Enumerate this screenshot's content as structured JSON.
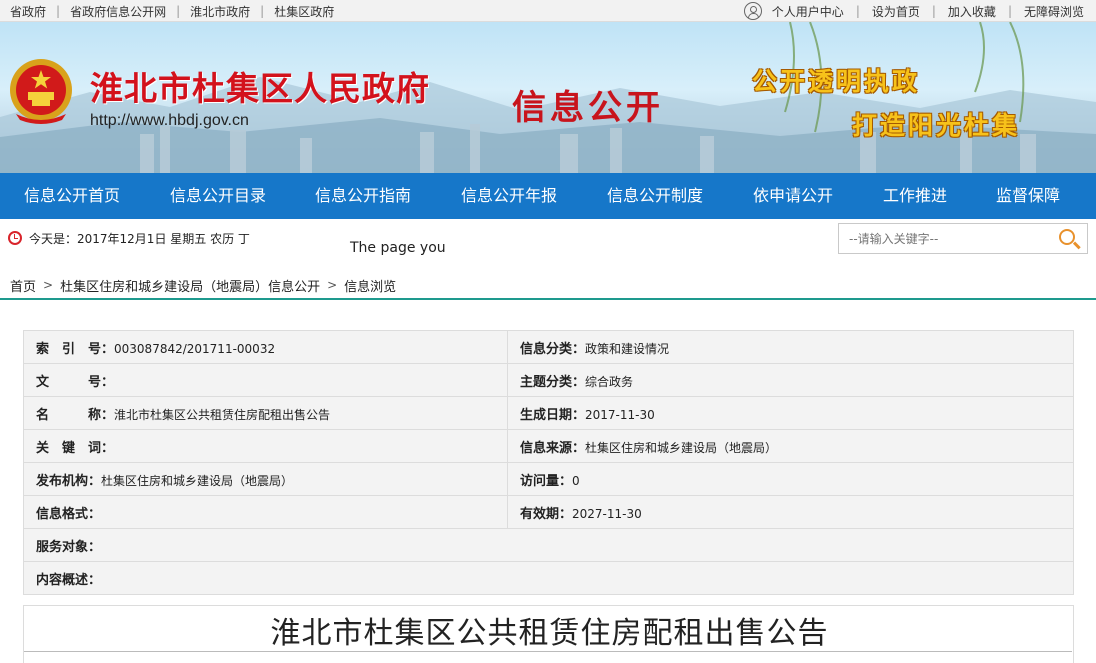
{
  "toplinks": [
    "省政府",
    "省政府信息公开网",
    "淮北市政府",
    "杜集区政府"
  ],
  "topright": [
    "个人用户中心",
    "设为首页",
    "加入收藏",
    "无障碍浏览"
  ],
  "banner": {
    "gov_title": "淮北市杜集区人民政府",
    "url": "http://www.hbdj.gov.cn",
    "info_open": "信息公开",
    "slogan1": "公开透明执政",
    "slogan2": "打造阳光杜集"
  },
  "nav": [
    "信息公开首页",
    "信息公开目录",
    "信息公开指南",
    "信息公开年报",
    "信息公开制度",
    "依申请公开",
    "工作推进",
    "监督保障"
  ],
  "date_text": "今天是：2017年12月1日 星期五 农历 丁",
  "marquee": "The page you",
  "search": {
    "placeholder": "--请输入关键字--"
  },
  "breadcrumb": [
    "首页",
    "杜集区住房和城乡建设局（地震局）信息公开",
    "信息浏览"
  ],
  "meta": {
    "index_label": "索　引　号：",
    "index_value": "003087842/201711-00032",
    "category_label": "信息分类：",
    "category_value": "政策和建设情况",
    "docno_label": "文　　　号：",
    "docno_value": "",
    "topic_label": "主题分类：",
    "topic_value": "综合政务",
    "name_label": "名　　　称：",
    "name_value": "淮北市杜集区公共租赁住房配租出售公告",
    "date_label": "生成日期：",
    "date_value": "2017-11-30",
    "keywords_label": "关　键　词：",
    "keywords_value": "",
    "source_label": "信息来源：",
    "source_value": "杜集区住房和城乡建设局（地震局）",
    "publisher_label": "发布机构：",
    "publisher_value": "杜集区住房和城乡建设局（地震局）",
    "visits_label": "访问量：",
    "visits_value": "0",
    "format_label": "信息格式：",
    "format_value": "",
    "validity_label": "有效期：",
    "validity_value": "2027-11-30",
    "audience_label": "服务对象：",
    "audience_value": "",
    "summary_label": "内容概述：",
    "summary_value": ""
  },
  "article": {
    "title": "淮北市杜集区公共租赁住房配租出售公告"
  },
  "colors": {
    "nav_blue": "#1677c9",
    "title_red": "#d3121c",
    "slogan_gold": "#f7c21a",
    "divider_teal": "#1e9a8e"
  },
  "icons": [
    "user-icon",
    "national-emblem-icon",
    "clock-icon",
    "search-icon",
    "chevron-right-icon"
  ]
}
